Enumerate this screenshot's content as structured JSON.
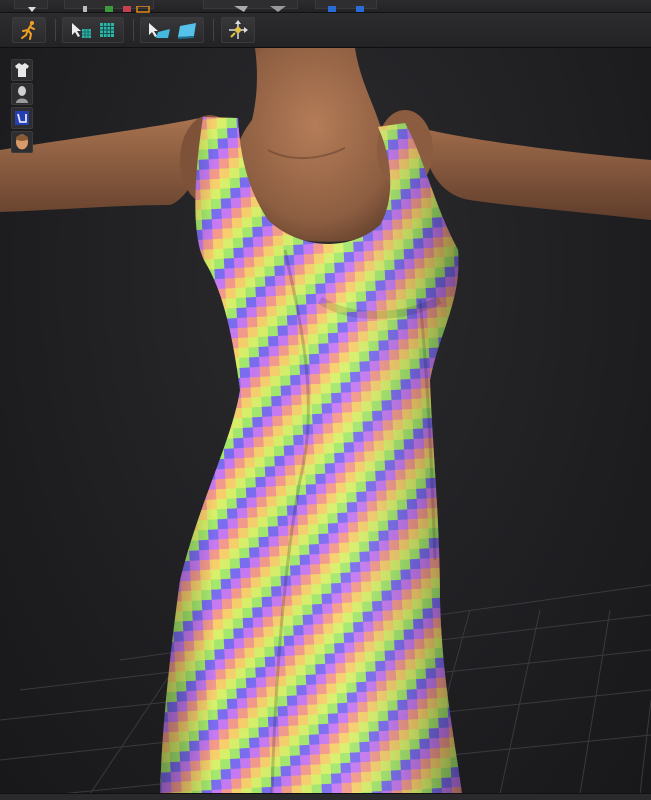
{
  "toolbar_top": {
    "icons": [
      "down-arrow-icon",
      "move-icon",
      "green-square-icon",
      "red-square-icon",
      "edit-icon",
      "brush-icon",
      "camera-icon",
      "blue-panel-icon"
    ]
  },
  "toolbar_main": {
    "icons": [
      "running-figure-icon",
      "select-mesh-icon",
      "texture-grid-icon",
      "select-plane-icon",
      "surface-icon",
      "pin-transform-icon"
    ]
  },
  "side_tools": {
    "icons": [
      "garment-icon",
      "avatar-head-icon",
      "fabric-icon",
      "face-icon"
    ]
  },
  "viewport": {
    "content": "3d-avatar-with-checker-dress",
    "pattern_colors": [
      "#7b6cf0",
      "#c77af2",
      "#f39a8c",
      "#f7d06c",
      "#d8f06a",
      "#a4e86e"
    ],
    "background_color": "#1f1f22",
    "skin_color": "#9a6a4a"
  }
}
